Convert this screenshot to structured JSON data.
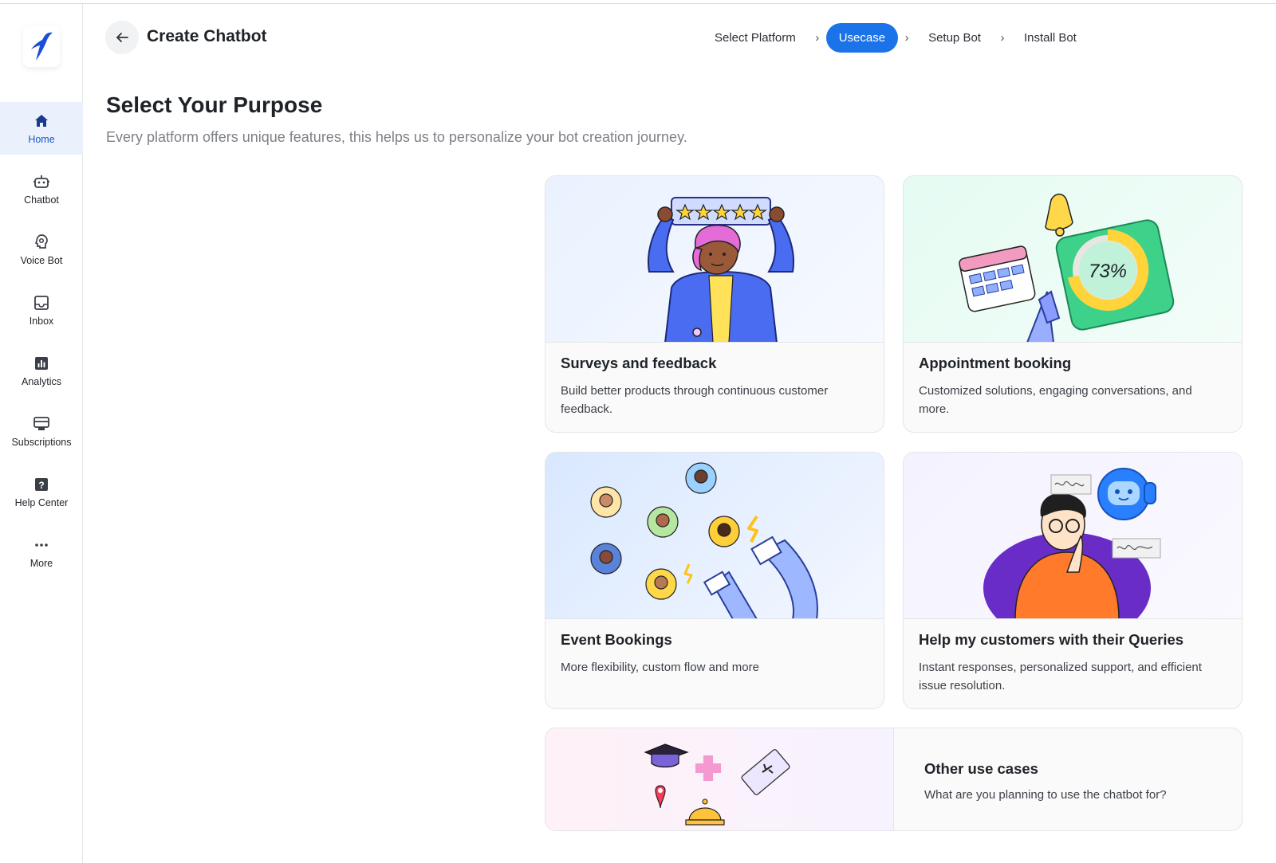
{
  "header": {
    "title": "Create Chatbot",
    "steps": [
      "Select Platform",
      "Usecase",
      "Setup Bot",
      "Install Bot"
    ],
    "active_step": "Usecase",
    "accent": "#1a73e8"
  },
  "sidebar": {
    "items": [
      {
        "label": "Home",
        "icon": "home-icon",
        "active": true
      },
      {
        "label": "Chatbot",
        "icon": "robot-icon"
      },
      {
        "label": "Voice Bot",
        "icon": "voice-bot-icon"
      },
      {
        "label": "Inbox",
        "icon": "inbox-icon"
      },
      {
        "label": "Analytics",
        "icon": "analytics-icon"
      },
      {
        "label": "Subscriptions",
        "icon": "subscriptions-icon"
      },
      {
        "label": "Help Center",
        "icon": "help-icon"
      },
      {
        "label": "More",
        "icon": "more-icon"
      }
    ]
  },
  "page": {
    "heading": "Select Your Purpose",
    "subheading": "Every platform offers unique features, this helps us to personalize your bot creation journey."
  },
  "cards": [
    {
      "title": "Surveys and feedback",
      "description": "Build better products through continuous customer feedback."
    },
    {
      "title": "Appointment booking",
      "description": "Customized solutions, engaging conversations, and more.",
      "illustration_text": "73%"
    },
    {
      "title": "Event Bookings",
      "description": "More flexibility, custom flow and more"
    },
    {
      "title": "Help my customers with their Queries",
      "description": "Instant responses, personalized support, and efficient issue resolution."
    },
    {
      "title": "Other use cases",
      "description": "What are you planning to use the chatbot for?"
    }
  ]
}
